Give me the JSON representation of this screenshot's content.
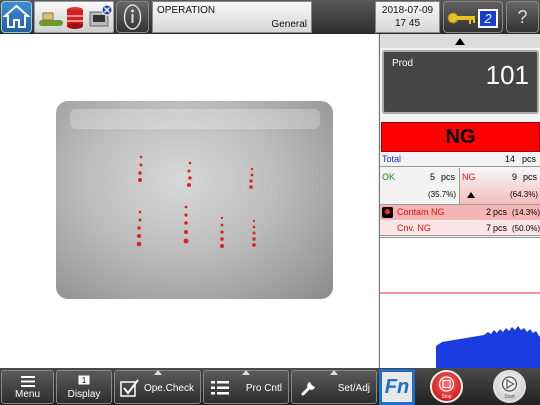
{
  "header": {
    "mode_title": "OPERATION",
    "mode_subtitle": "General",
    "date": "2018-07-09",
    "time": "17 45",
    "key_level": "2",
    "help_label": "?"
  },
  "production": {
    "label": "Prod",
    "count": "101",
    "judgement": "NG"
  },
  "stats": {
    "total_label": "Total",
    "total_value": "14",
    "unit": "pcs",
    "ok_label": "OK",
    "ok_value": "5",
    "ok_percent": "(35.7%)",
    "ng_label": "NG",
    "ng_value": "9",
    "ng_percent": "(64.3%)",
    "contam_label": "Contam NG",
    "contam_value": "2",
    "contam_percent": "(14.3%)",
    "cnv_label": "Cnv. NG",
    "cnv_value": "7",
    "cnv_percent": "(50.0%)"
  },
  "bottom": {
    "menu": "Menu",
    "display": "Display",
    "opecheck": "Ope.Check",
    "procntl": "Pro Cntl",
    "setadj": "Set/Adj",
    "fn": "Fn",
    "stop": "Stop",
    "start": "Start"
  },
  "colors": {
    "ng_red": "#ff0000",
    "ok_green": "#109010",
    "total_blue": "#1030d0",
    "fn_blue": "#1d6fc9",
    "stop_red": "#e02020",
    "start_gray": "#e0e0e0"
  },
  "icons": {
    "home": "house-icon",
    "info": "info-icon",
    "key": "key-icon",
    "help": "question-icon"
  }
}
